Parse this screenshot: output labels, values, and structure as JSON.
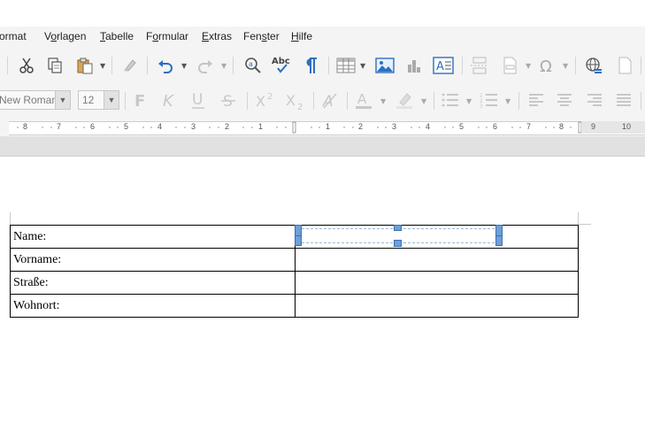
{
  "menubar": {
    "items": [
      {
        "label": "Format",
        "shown": "ormat"
      },
      {
        "label": "Vorlagen",
        "shown": "Vorlagen"
      },
      {
        "label": "Tabelle",
        "shown": "Tabelle"
      },
      {
        "label": "Formular",
        "shown": "Formular"
      },
      {
        "label": "Extras",
        "shown": "Extras"
      },
      {
        "label": "Fenster",
        "shown": "Fenster"
      },
      {
        "label": "Hilfe",
        "shown": "Hilfe"
      }
    ]
  },
  "toolbar": {
    "font_name": "New Roman",
    "font_size": "12"
  },
  "ruler": {
    "labels": [
      "8",
      "7",
      "6",
      "5",
      "4",
      "3",
      "2",
      "1",
      "1",
      "2",
      "3",
      "4",
      "5",
      "6",
      "7",
      "8",
      "9",
      "10"
    ]
  },
  "table": {
    "rows": [
      {
        "label": "Name:",
        "value": ""
      },
      {
        "label": "Vorname:",
        "value": ""
      },
      {
        "label": "Straße:",
        "value": ""
      },
      {
        "label": "Wohnort:",
        "value": ""
      }
    ]
  },
  "colors": {
    "accent": "#2e6fbf",
    "toolbar_bg": "#f4f4f4",
    "selection_handle": "#6f9fd8"
  }
}
